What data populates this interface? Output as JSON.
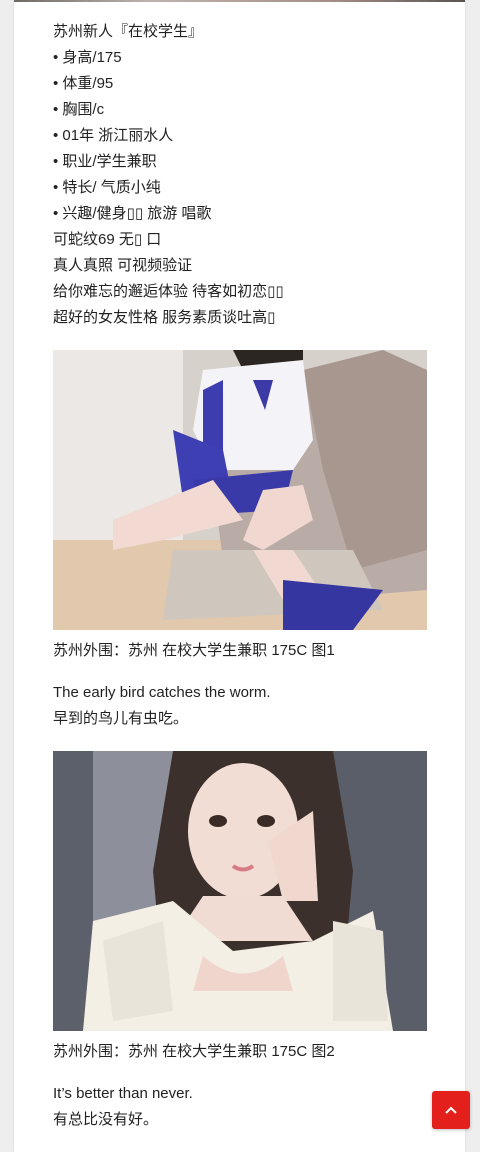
{
  "post": {
    "intro_lines": [
      "苏州新人『在校学生』",
      "• 身高/175",
      "• 体重/95",
      "• 胸围/c",
      "• 01年 浙江丽水人",
      "• 职业/学生兼职",
      "• 特长/ 气质小纯",
      "• 兴趣/健身▯▯ 旅游 唱歌",
      "可蛇纹69 无▯ 口",
      "真人真照 可视频验证",
      "给你难忘的邂逅体验 待客如初恋▯▯",
      "超好的女友性格 服务素质谈吐高▯"
    ],
    "figure_1": {
      "caption": "苏州外围：苏州 在校大学生兼职 175C 图1"
    },
    "quote_1": {
      "english": "The early bird catches the worm.",
      "chinese": "早到的鸟儿有虫吃。"
    },
    "figure_2": {
      "caption": "苏州外围：苏州 在校大学生兼职 175C 图2"
    },
    "quote_2": {
      "english": "It’s better than never.",
      "chinese": "有总比没有好。"
    }
  },
  "back_to_top": {
    "icon": "chevron-up-icon",
    "color": "#e3201b"
  }
}
